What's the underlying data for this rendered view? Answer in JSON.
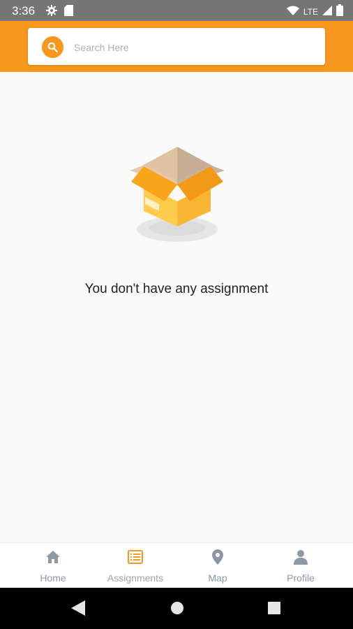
{
  "status_bar": {
    "time": "3:36",
    "network": "LTE",
    "icons": [
      "settings-icon",
      "sd-card-icon",
      "wifi-icon",
      "signal-icon",
      "battery-icon"
    ]
  },
  "search": {
    "placeholder": "Search Here",
    "value": "",
    "icon": "search-icon"
  },
  "empty_state": {
    "message": "You don't have any assignment",
    "illustration": "open-box-icon"
  },
  "bottom_nav": {
    "items": [
      {
        "label": "Home",
        "icon": "home-icon"
      },
      {
        "label": "Assignments",
        "icon": "assignments-icon",
        "active": true
      },
      {
        "label": "Map",
        "icon": "map-pin-icon"
      },
      {
        "label": "Profile",
        "icon": "person-icon"
      }
    ]
  },
  "system_nav": {
    "buttons": [
      "back-icon",
      "home-circle-icon",
      "recents-icon"
    ]
  },
  "colors": {
    "accent": "#f7971e",
    "status_bar": "#757575",
    "nav_inactive": "#8c98a4",
    "background": "#fafafa"
  }
}
